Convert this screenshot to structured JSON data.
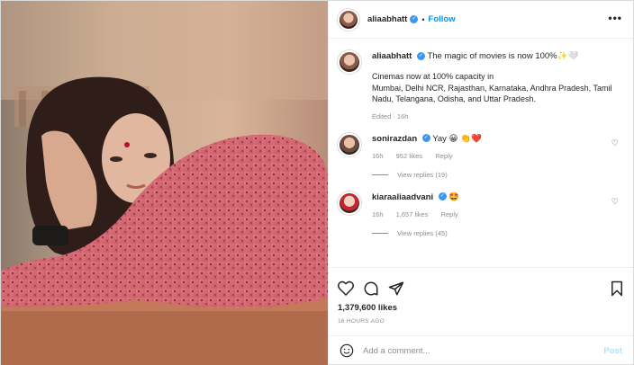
{
  "post": {
    "username": "aliaabhatt",
    "follow_label": "Follow",
    "more_label": "•••",
    "dot": "•"
  },
  "caption": {
    "username": "aliaabhatt",
    "headline": "The magic of movies is now 100%✨🤍",
    "body": "Cinemas now at 100% capacity in\nMumbai, Delhi NCR, Rajasthan, Karnataka, Andhra Pradesh, Tamil Nadu, Telangana, Odisha, and Uttar Pradesh.",
    "edited": "Edited · 16h"
  },
  "comments": [
    {
      "username": "sonirazdan",
      "text": "Yay 😀 👏❤️",
      "time": "16h",
      "likes": "952 likes",
      "reply": "Reply",
      "view_replies": "View replies (19)"
    },
    {
      "username": "kiaraaliaadvani",
      "text": "🤩",
      "time": "16h",
      "likes": "1,657 likes",
      "reply": "Reply",
      "view_replies": "View replies (45)"
    }
  ],
  "stats": {
    "likes": "1,379,600 likes",
    "time": "16 HOURS AGO"
  },
  "add_comment": {
    "placeholder": "Add a comment...",
    "post_label": "Post"
  },
  "colors": {
    "accent": "#0095f6",
    "muted": "#8e8e8e",
    "verified": "#3897f0"
  },
  "icons": [
    "heart-icon",
    "comment-icon",
    "share-icon",
    "bookmark-icon",
    "emoji-icon",
    "verified-icon"
  ]
}
